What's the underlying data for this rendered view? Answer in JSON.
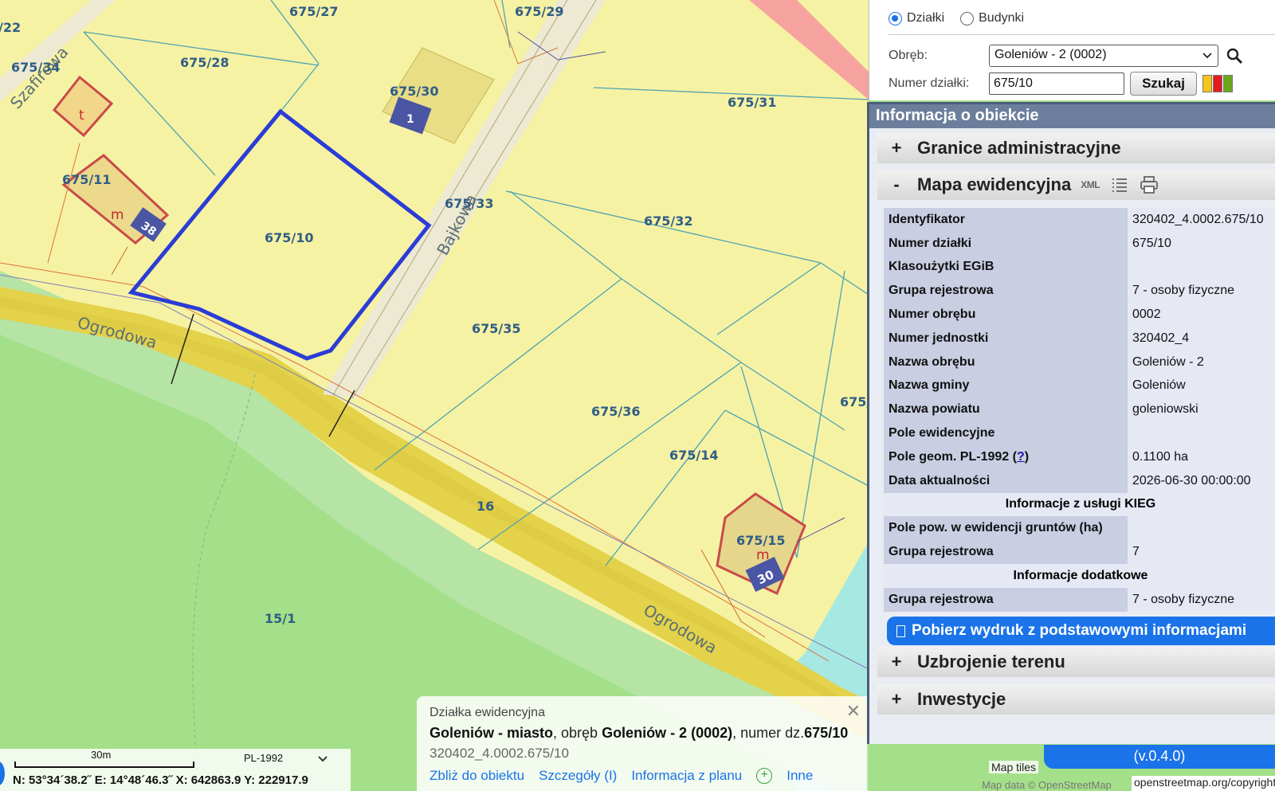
{
  "search": {
    "radio_parcels": "Działki",
    "radio_buildings": "Budynki",
    "obreb_label": "Obręb:",
    "obreb_value": "Goleniów - 2 (0002)",
    "parcel_number_label": "Numer działki:",
    "parcel_number_value": "675/10",
    "search_button": "Szukaj",
    "swatch_colors": [
      "#f5c518",
      "#e31b1b",
      "#6aa81a"
    ]
  },
  "info_panel": {
    "title": "Informacja o obiekcie",
    "sections": {
      "admin": {
        "sign": "+",
        "label": "Granice administracyjne"
      },
      "cadastral": {
        "sign": "-",
        "label": "Mapa ewidencyjna",
        "xml": "XML"
      },
      "utilities": {
        "sign": "+",
        "label": "Uzbrojenie terenu"
      },
      "investments": {
        "sign": "+",
        "label": "Inwestycje"
      }
    },
    "attributes": [
      {
        "key": "Identyfikator",
        "value": "320402_4.0002.675/10"
      },
      {
        "key": "Numer działki",
        "value": "675/10"
      },
      {
        "key": "Klasoużytki EGiB",
        "value": ""
      },
      {
        "key": "Grupa rejestrowa",
        "value": "7 - osoby fizyczne"
      },
      {
        "key": "Numer obrębu",
        "value": "0002"
      },
      {
        "key": "Numer jednostki",
        "value": "320402_4"
      },
      {
        "key": "Nazwa obrębu",
        "value": "Goleniów - 2"
      },
      {
        "key": "Nazwa gminy",
        "value": "Goleniów"
      },
      {
        "key": "Nazwa powiatu",
        "value": "goleniowski"
      },
      {
        "key": "Pole ewidencyjne",
        "value": ""
      },
      {
        "key": "Pole geom. PL-1992 (",
        "help": "?",
        "key_suffix": ")",
        "value": "0.1100 ha"
      },
      {
        "key": "Data aktualności",
        "value": "2026-06-30 00:00:00"
      }
    ],
    "kieg_header": "Informacje z usługi KIEG",
    "kieg_attributes": [
      {
        "key": "Pole pow. w ewidencji gruntów (ha)",
        "value": ""
      },
      {
        "key": "Grupa rejestrowa",
        "value": "7"
      }
    ],
    "extra_header": "Informacje dodatkowe",
    "extra_attributes": [
      {
        "key": "Grupa rejestrowa",
        "value": "7 - osoby fizyczne"
      }
    ],
    "print_button": "Pobierz wydruk z podstawowymi informacjami"
  },
  "popup": {
    "category": "Działka ewidencyjna",
    "location_bold1": "Goleniów - miasto",
    "location_text1": ", obręb ",
    "location_bold2": "Goleniów - 2 (0002)",
    "location_text2": ", numer dz.",
    "location_bold3": "675/10",
    "identifier": "320402_4.0002.675/10",
    "links": [
      "Zbliż do obiektu",
      "Szczegóły (I)",
      "Informacja z planu",
      "Inne"
    ]
  },
  "map": {
    "parcels": [
      "675/27",
      "675/29",
      "/22",
      "675/34",
      "675/28",
      "675/30",
      "675/31",
      "675/11",
      "675/33",
      "675/32",
      "675/10",
      "675/35",
      "675/36",
      "675/14",
      "675/15",
      "16",
      "15/1",
      "675/"
    ],
    "streets": [
      "Szafirowa",
      "Bajkowa",
      "Ogrodowa",
      "Ogrodowa"
    ],
    "building_numbers": [
      "1",
      "38",
      "30"
    ],
    "building_types": [
      "t",
      "m",
      "m"
    ]
  },
  "scalebar": {
    "scale": "30m",
    "crs": "PL-1992",
    "coords": "N: 53°34´38.2˝  E: 14°48´46.3˝  X: 642863.9   Y: 222917.9"
  },
  "footer": {
    "version": "(v.0.4.0)",
    "map_tiles": "Map tiles",
    "osm_link": "openstreetmap.org/copyright",
    "map_data": "Map data © OpenStreetMap"
  }
}
